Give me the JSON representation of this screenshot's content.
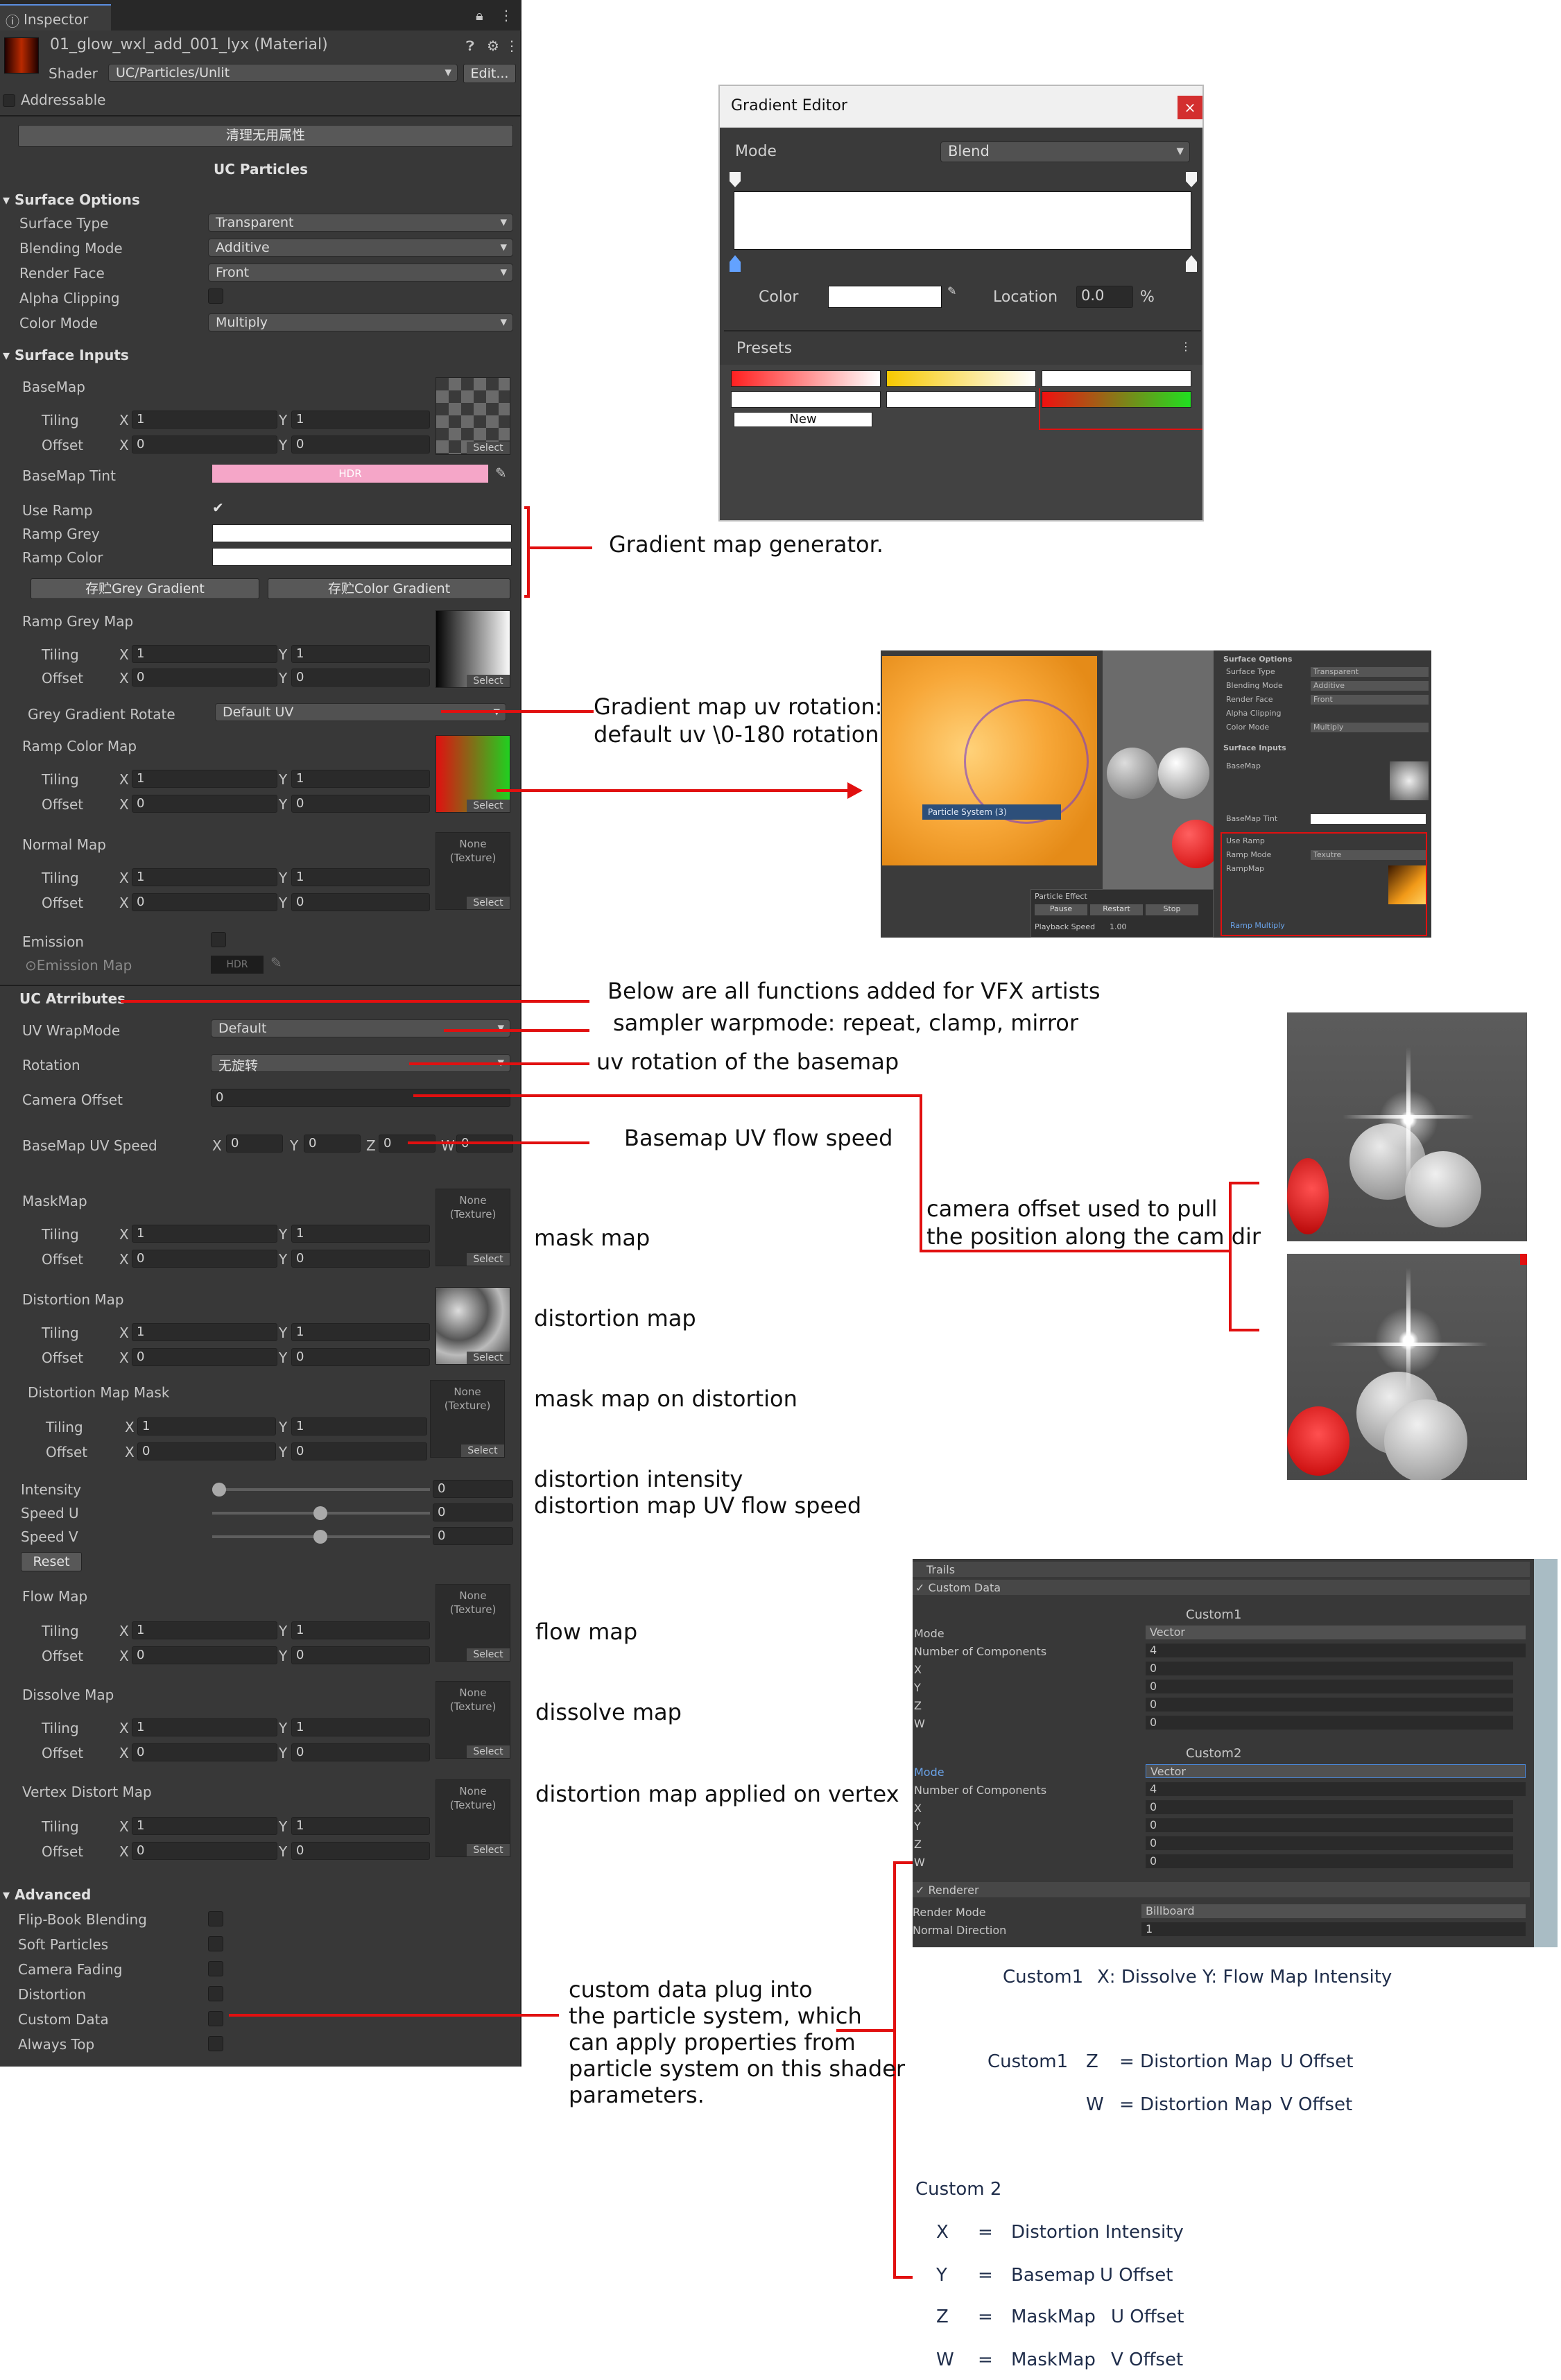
{
  "inspector": {
    "tab": "Inspector",
    "material_name": "01_glow_wxl_add_001_lyx (Material)",
    "shader_label": "Shader",
    "shader_value": "UC/Particles/Unlit",
    "edit_label": "Edit...",
    "addressable": "Addressable",
    "clear_button": "清理无用属性",
    "section_title": "UC Particles",
    "surface_options": {
      "title": "Surface Options",
      "rows": [
        {
          "label": "Surface Type",
          "value": "Transparent"
        },
        {
          "label": "Blending Mode",
          "value": "Additive"
        },
        {
          "label": "Render Face",
          "value": "Front"
        },
        {
          "label": "Alpha Clipping",
          "value": ""
        },
        {
          "label": "Color Mode",
          "value": "Multiply"
        }
      ]
    },
    "surface_inputs": {
      "title": "Surface Inputs",
      "basemap": "BaseMap",
      "basemap_tint": "BaseMap Tint",
      "hdr": "HDR",
      "use_ramp": "Use Ramp",
      "ramp_grey": "Ramp Grey",
      "ramp_color": "Ramp Color",
      "save_grey": "存贮Grey Gradient",
      "save_color": "存贮Color Gradient",
      "ramp_grey_map": "Ramp Grey Map",
      "grey_gradient_rotate": "Grey Gradient Rotate",
      "grey_gradient_rotate_value": "Default UV",
      "ramp_color_map": "Ramp Color Map",
      "normal_map": "Normal Map",
      "emission": "Emission",
      "emission_map": "Emission Map"
    },
    "common": {
      "tiling": "Tiling",
      "offset": "Offset",
      "x": "X",
      "y": "Y",
      "z": "Z",
      "w": "W",
      "one": "1",
      "zero": "0",
      "select": "Select",
      "none_texture": "None (Texture)"
    },
    "uc_attributes": {
      "title": "UC Atrributes",
      "uv_wrapmode": "UV WrapMode",
      "uv_wrapmode_value": "Default",
      "rotation": "Rotation",
      "rotation_value": "无旋转",
      "camera_offset": "Camera Offset",
      "camera_offset_value": "0",
      "basemap_uv_speed": "BaseMap UV Speed",
      "mask_map": "MaskMap",
      "distortion_map": "Distortion Map",
      "distortion_map_mask": "Distortion Map Mask",
      "intensity": "Intensity",
      "speed_u": "Speed U",
      "speed_v": "Speed V",
      "reset": "Reset",
      "flow_map": "Flow Map",
      "dissolve_map": "Dissolve Map",
      "vertex_distort_map": "Vertex Distort Map"
    },
    "advanced": {
      "title": "Advanced",
      "items": [
        "Flip-Book Blending",
        "Soft Particles",
        "Camera Fading",
        "Distortion",
        "Custom Data",
        "Always Top"
      ]
    }
  },
  "gradient_editor": {
    "title": "Gradient Editor",
    "mode_label": "Mode",
    "mode_value": "Blend",
    "color_label": "Color",
    "location_label": "Location",
    "location_value": "0.0",
    "percent": "%",
    "presets": "Presets",
    "new_label": "New"
  },
  "scene_panel": {
    "surface_options": "Surface Options",
    "surface_type": "Surface Type",
    "blending_mode": "Blending Mode",
    "render_face": "Render Face",
    "alpha_clipping": "Alpha Clipping",
    "color_mode": "Color Mode",
    "surface_inputs": "Surface Inputs",
    "basemap": "BaseMap",
    "basemap_tint": "BaseMap Tint",
    "use_ramp": "Use Ramp",
    "ramp_mode": "Ramp Mode",
    "ramp_mode_value": "Texutre",
    "ramp_map": "RampMap",
    "ramp_multiply": "Ramp Multiply",
    "particle_effect": "Particle Effect",
    "pause": "Pause",
    "restart": "Restart",
    "stop": "Stop",
    "playback_speed": "Playback Speed",
    "playback_value": "1.00",
    "particle_system": "Particle System (3)"
  },
  "custom_data_panel": {
    "trails": "Trails",
    "custom_data": "Custom Data",
    "custom1": "Custom1",
    "custom2": "Custom2",
    "mode": "Mode",
    "mode_value": "Vector",
    "num_components": "Number of Components",
    "num_value": "4",
    "x": "X",
    "y": "Y",
    "z": "Z",
    "w": "W",
    "zero": "0",
    "renderer": "Renderer",
    "render_mode": "Render Mode",
    "render_mode_value": "Billboard",
    "normal_direction": "Normal Direction",
    "normal_value": "1"
  },
  "annotations": {
    "gradient_generator": "Gradient map generator.",
    "uv_rotation_1": "Gradient map uv rotation:",
    "uv_rotation_2": "default uv \\0-180 rotation",
    "vfx_functions": "Below are all functions added for VFX artists",
    "sampler": "sampler warpmode: repeat, clamp, mirror",
    "uv_rotation_basemap": "uv rotation of the basemap",
    "basemap_flow": "Basemap UV flow speed",
    "camera_offset_1": "camera offset used to pull",
    "camera_offset_2": "the position along the cam dir",
    "mask_map": "mask map",
    "distortion_map": "distortion map",
    "mask_on_distortion": "mask map on distortion",
    "distortion_intensity": "distortion intensity",
    "distortion_flow": "distortion map UV flow speed",
    "flow_map": "flow map",
    "dissolve_map": "dissolve map",
    "vertex_distort": "distortion map applied on vertex",
    "custom_1": "custom data plug into",
    "custom_2": "the particle system, which",
    "custom_3": "can apply properties from",
    "custom_4": "particle system on this shader",
    "custom_5": "parameters."
  },
  "custom_mapping": {
    "c1_label": "Custom1",
    "c1_line": "X: Dissolve  Y: Flow Map Intensity",
    "c1b_label": "Custom1",
    "c1b_z": "Z",
    "c1b_z_val": "= Distortion Map",
    "c1b_z_axis": "U Offset",
    "c1b_w": "W",
    "c1b_w_val": "= Distortion Map",
    "c1b_w_axis": "V Offset",
    "c2_label": "Custom 2",
    "rows": [
      {
        "k": "X",
        "eq": "=",
        "name": "Distortion Intensity",
        "axis": ""
      },
      {
        "k": "Y",
        "eq": "=",
        "name": "Basemap",
        "axis": "U Offset"
      },
      {
        "k": "Z",
        "eq": "=",
        "name": "MaskMap",
        "axis": "U Offset"
      },
      {
        "k": "W",
        "eq": "=",
        "name": "MaskMap",
        "axis": "V Offset"
      }
    ]
  },
  "colors": {
    "inspector_bg": "#383838",
    "annotation_line": "#e11010",
    "tint_pink": "#f5a6c8"
  }
}
